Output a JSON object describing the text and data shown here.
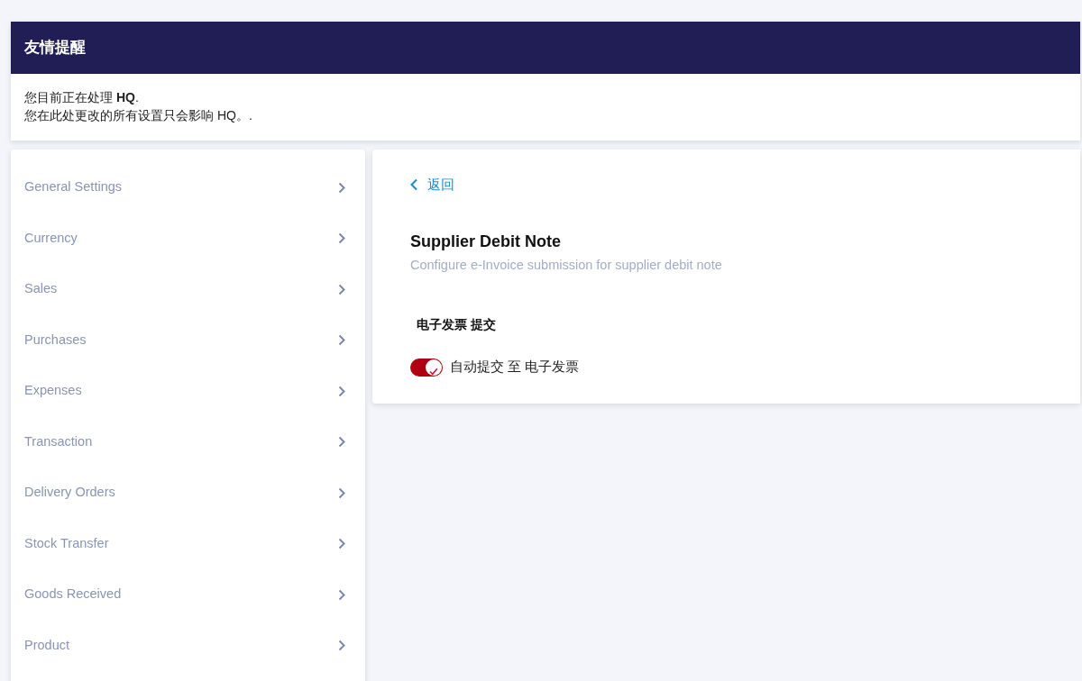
{
  "notice": {
    "title": "友情提醒",
    "lines": [
      "您目前正在处理 **HQ**.",
      "您在此处更改的所有设置只会影响 HQ。."
    ]
  },
  "sidebar": {
    "items": [
      {
        "label": "General Settings"
      },
      {
        "label": "Currency"
      },
      {
        "label": "Sales"
      },
      {
        "label": "Purchases"
      },
      {
        "label": "Expenses"
      },
      {
        "label": "Transaction"
      },
      {
        "label": "Delivery Orders"
      },
      {
        "label": "Stock Transfer"
      },
      {
        "label": "Goods Received"
      },
      {
        "label": "Product"
      }
    ]
  },
  "panel": {
    "back": "返回",
    "title": "Supplier Debit Note",
    "subtitle": "Configure e-Invoice submission for supplier debit note",
    "section": "电子发票 提交",
    "toggle": {
      "label": "自动提交 至 电子发票",
      "on": true
    }
  }
}
